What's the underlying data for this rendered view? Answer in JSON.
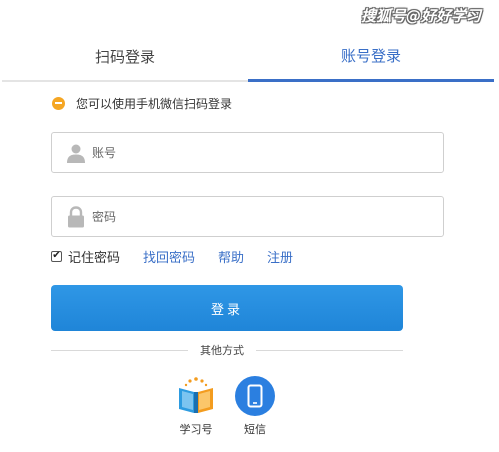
{
  "watermark": "搜狐号@好好学习",
  "tabs": {
    "qr_label": "扫码登录",
    "account_label": "账号登录"
  },
  "notice": {
    "text": "您可以使用手机微信扫码登录",
    "icon": "minus-circle-icon",
    "color": "#f5a623"
  },
  "form": {
    "username_placeholder": "账号",
    "username_value": "",
    "password_placeholder": "密码",
    "password_value": ""
  },
  "options": {
    "remember_label": "记住密码",
    "remember_checked": true,
    "recover_label": "找回密码",
    "help_label": "帮助",
    "register_label": "注册"
  },
  "login_button": "登录",
  "other_methods": {
    "label": "其他方式",
    "items": [
      {
        "label": "学习号",
        "icon": "open-book-icon"
      },
      {
        "label": "短信",
        "icon": "mobile-phone-icon"
      }
    ]
  },
  "colors": {
    "accent": "#3a6fc7",
    "button": "#2088da",
    "sms": "#2b7fe0"
  }
}
